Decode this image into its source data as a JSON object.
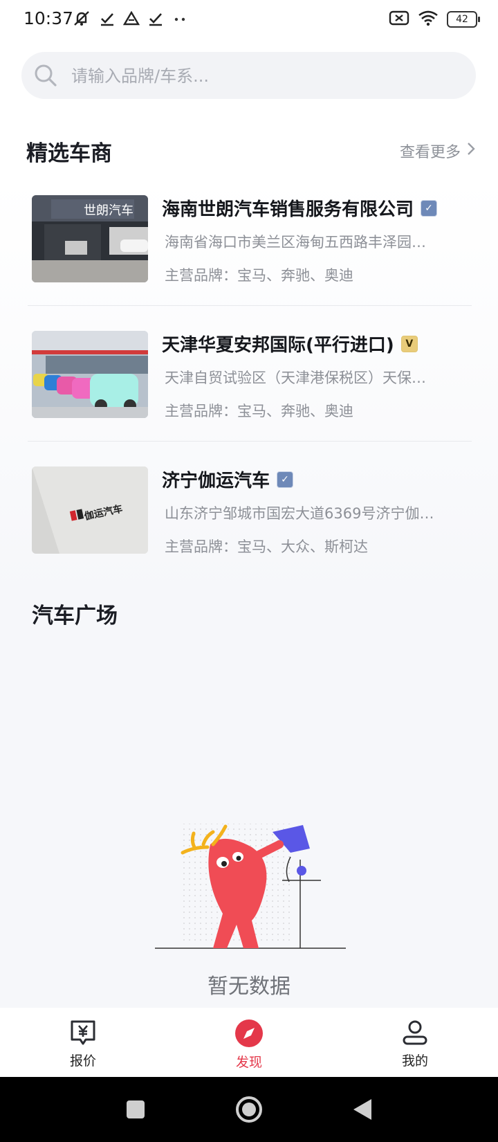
{
  "status_bar": {
    "time": "10:37",
    "battery": "42",
    "icons": [
      "mute-icon",
      "check-icon",
      "drive-icon",
      "check-icon",
      "more-dots-icon",
      "sim-off-icon",
      "wifi-icon",
      "battery-icon"
    ]
  },
  "search": {
    "placeholder": "请输入品牌/车系..."
  },
  "featured": {
    "title": "精选车商",
    "more_label": "查看更多",
    "dealers": [
      {
        "name": "海南世朗汽车销售服务有限公司",
        "badge": "blue",
        "address": "海南省海口市美兰区海甸五西路丰泽园…",
        "brands": "主营品牌：宝马、奔驰、奥迪",
        "sign_text": "世朗汽车"
      },
      {
        "name": "天津华夏安邦国际(平行进口)",
        "badge": "gold",
        "address": "天津自贸试验区（天津港保税区）天保…",
        "brands": "主营品牌：宝马、奔驰、奥迪"
      },
      {
        "name": "济宁伽运汽车",
        "badge": "blue",
        "address": "山东济宁邹城市国宏大道6369号济宁伽…",
        "brands": "主营品牌：宝马、大众、斯柯达",
        "logo_text": "伽运汽车"
      }
    ]
  },
  "plaza": {
    "title": "汽车广场",
    "empty_text": "暂无数据"
  },
  "tabs": [
    {
      "label": "报价",
      "icon": "yuan-chat-icon",
      "active": false
    },
    {
      "label": "发现",
      "icon": "compass-icon",
      "active": true
    },
    {
      "label": "我的",
      "icon": "user-icon",
      "active": false
    }
  ],
  "colors": {
    "accent": "#e4384a",
    "background": "#f6f7fa"
  }
}
